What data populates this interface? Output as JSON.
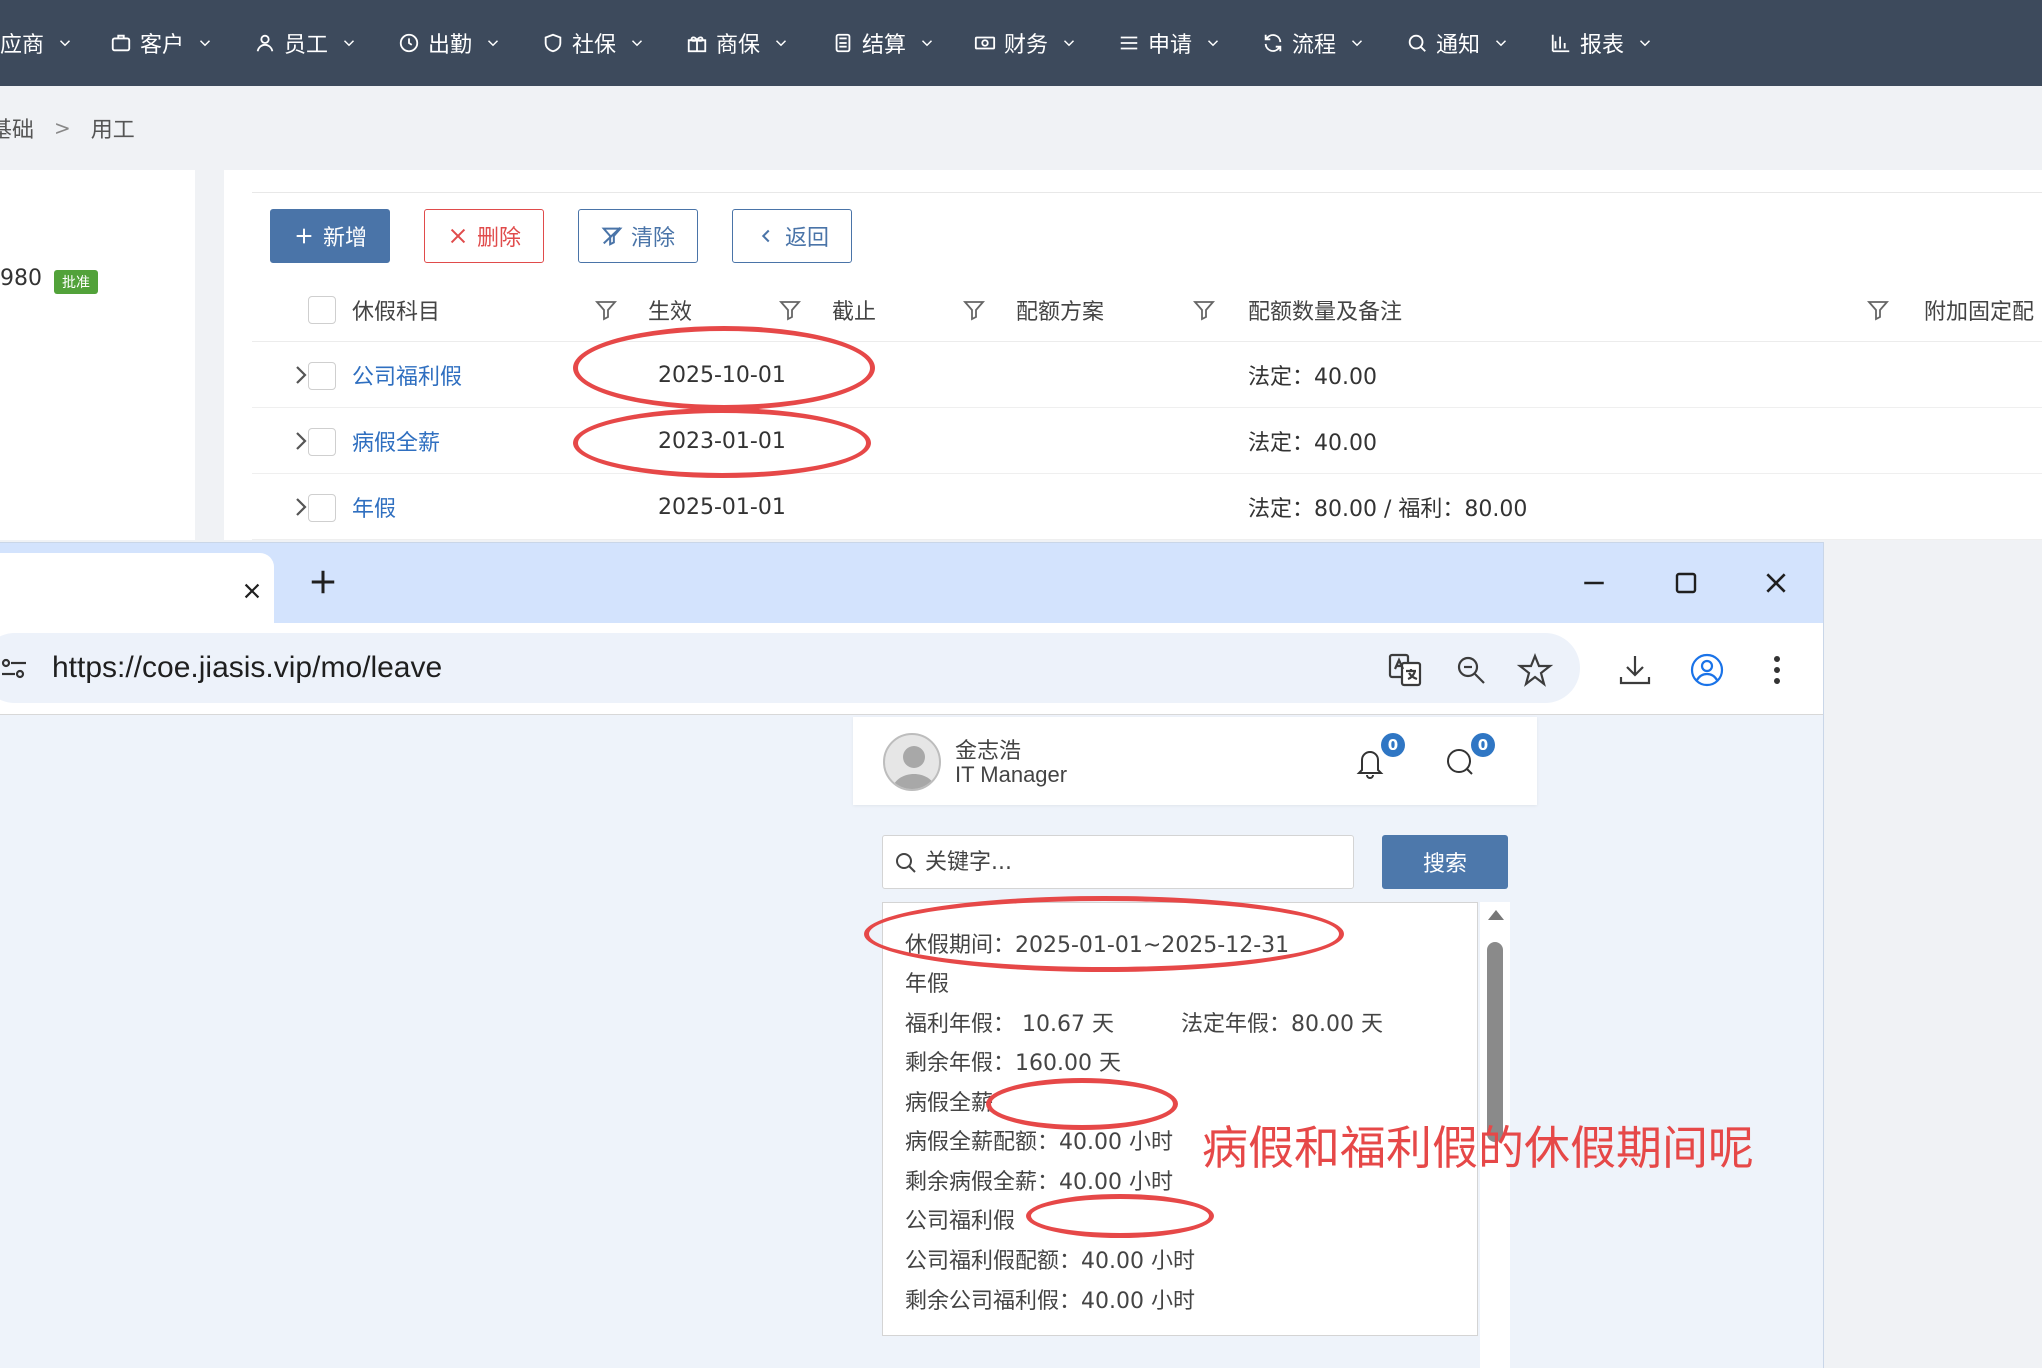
{
  "topnav": {
    "items": [
      {
        "label": "应商",
        "icon": "supplier-icon"
      },
      {
        "label": "客户",
        "icon": "briefcase-icon"
      },
      {
        "label": "员工",
        "icon": "user-icon"
      },
      {
        "label": "出勤",
        "icon": "clock-icon"
      },
      {
        "label": "社保",
        "icon": "shield-icon"
      },
      {
        "label": "商保",
        "icon": "gift-icon"
      },
      {
        "label": "结算",
        "icon": "calculator-icon"
      },
      {
        "label": "财务",
        "icon": "money-icon"
      },
      {
        "label": "申请",
        "icon": "list-icon"
      },
      {
        "label": "流程",
        "icon": "refresh-icon"
      },
      {
        "label": "通知",
        "icon": "chat-search-icon"
      },
      {
        "label": "报表",
        "icon": "bar-chart-icon"
      }
    ]
  },
  "breadcrumb": {
    "items": [
      "基础",
      "用工"
    ],
    "separator": ">"
  },
  "left_panel": {
    "number": "980",
    "badge": "批准"
  },
  "toolbar": {
    "add": "新增",
    "delete": "删除",
    "clear": "清除",
    "back": "返回"
  },
  "table": {
    "headers": [
      "休假科目",
      "生效",
      "截止",
      "配额方案",
      "配额数量及备注",
      "附加固定配"
    ],
    "rows": [
      {
        "subject": "公司福利假",
        "effective": "2025-10-01",
        "end": "",
        "plan": "",
        "quota": "法定：40.00"
      },
      {
        "subject": "病假全薪",
        "effective": "2023-01-01",
        "end": "",
        "plan": "",
        "quota": "法定：40.00"
      },
      {
        "subject": "年假",
        "effective": "2025-01-01",
        "end": "",
        "plan": "",
        "quota": "法定：80.00 / 福利：80.00"
      }
    ]
  },
  "browser": {
    "url": "https://coe.jiasis.vip/mo/leave",
    "tab_title": ""
  },
  "profile": {
    "name": "金志浩",
    "role": "IT Manager",
    "notifications": "0",
    "messages": "0"
  },
  "search": {
    "placeholder": "关键字...",
    "button": "搜索"
  },
  "leave_info": {
    "period": "休假期间：2025-01-01~2025-12-31",
    "annual_title": "年假",
    "welfare_annual": "福利年假： 10.67 天",
    "legal_annual": "法定年假：80.00 天",
    "remaining_annual": "剩余年假：160.00 天",
    "sick_title": "病假全薪",
    "sick_quota": "病假全薪配额：40.00 小时",
    "sick_remaining": "剩余病假全薪：40.00 小时",
    "welfare_title": "公司福利假",
    "welfare_quota": "公司福利假配额：40.00 小时",
    "welfare_remaining": "剩余公司福利假：40.00 小时"
  },
  "annotation": "病假和福利假的休假期间呢",
  "colors": {
    "nav_bg": "#3d4a5c",
    "primary": "#4a74a8",
    "danger": "#e04b4b",
    "link": "#2f6fc0",
    "annotation_red": "#e64848",
    "badge_green": "#52a23a"
  }
}
